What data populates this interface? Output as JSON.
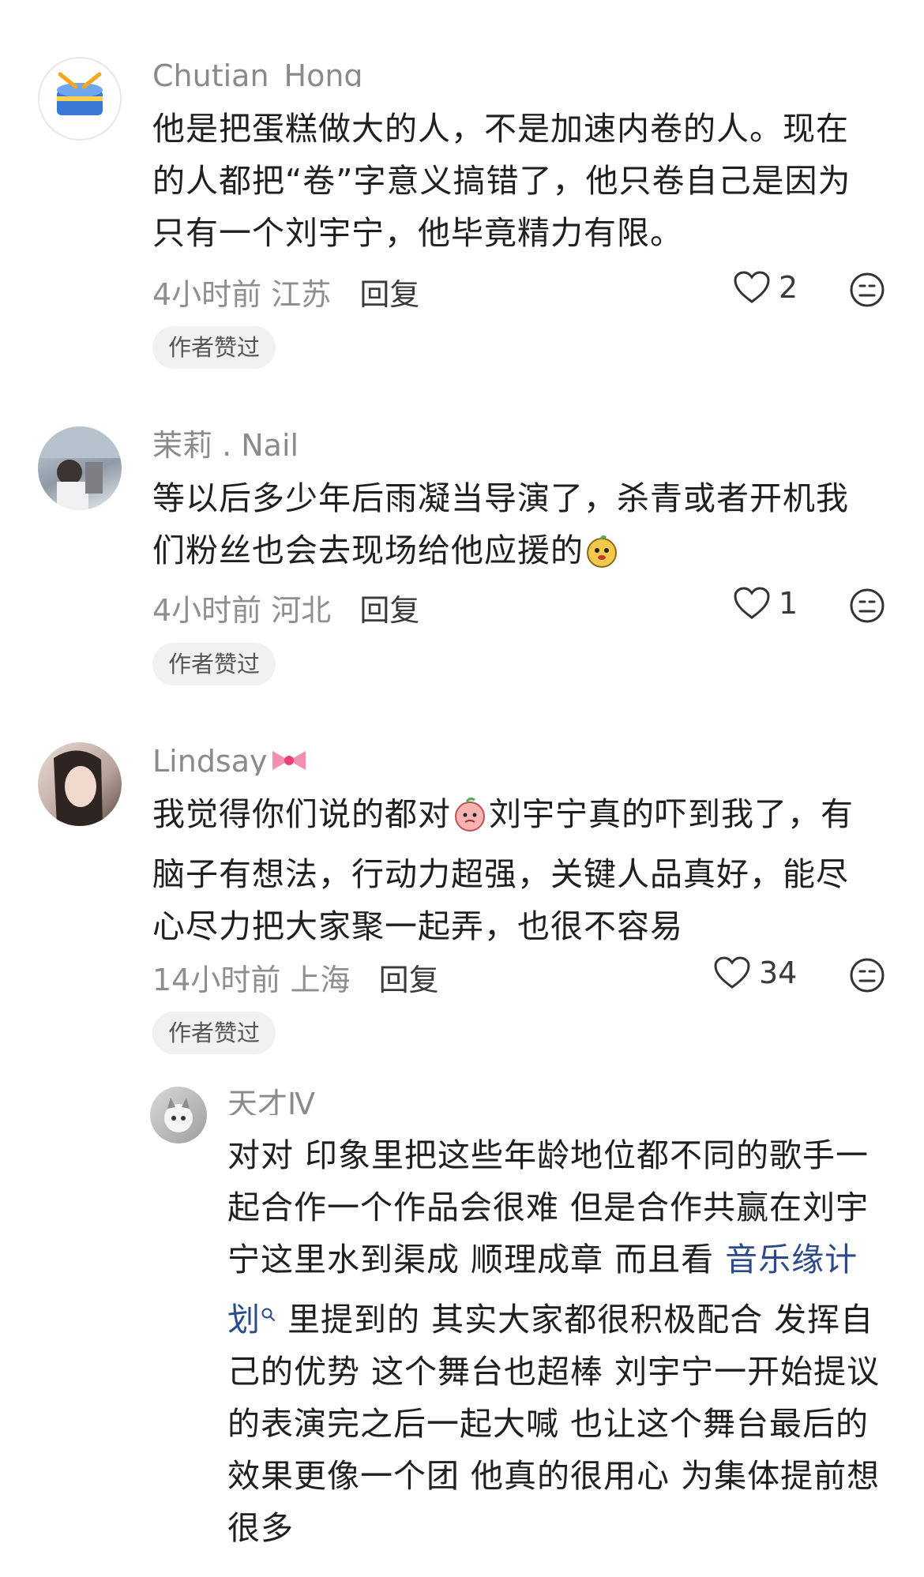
{
  "comments": [
    {
      "username": "Chutian_Hong",
      "text": "他是把蛋糕做大的人，不是加速内卷的人。现在的人都把“卷”字意义搞错了，他只卷自己是因为只有一个刘宇宁，他毕竟精力有限。",
      "time": "4小时前",
      "location": "江苏",
      "reply_label": "回复",
      "likes": "2",
      "badge": "作者赞过"
    },
    {
      "username": "茉莉 . Nail",
      "text": "等以后多少年后雨凝当导演了，杀青或者开机我们粉丝也会去现场给他应援的",
      "time": "4小时前",
      "location": "河北",
      "reply_label": "回复",
      "likes": "1",
      "badge": "作者赞过"
    },
    {
      "username": "Lindsay",
      "text_before": "我觉得你们说的都对",
      "text_after": "刘宇宁真的吓到我了，有脑子有想法，行动力超强，关键人品真好，能尽心尽力把大家聚一起弄，也很不容易",
      "time": "14小时前",
      "location": "上海",
      "reply_label": "回复",
      "likes": "34",
      "badge": "作者赞过"
    }
  ],
  "reply": {
    "username": "天才Ⅳ",
    "text_before": "对对 印象里把这些年龄地位都不同的歌手一起合作一个作品会很难 但是合作共赢在刘宇宁这里水到渠成 顺理成章 而且看 ",
    "link_text": "音乐缘计划",
    "text_after": " 里提到的 其实大家都很积极配合 发挥自己的优势 这个舞台也超棒 刘宇宁一开始提议的表演完之后一起大喊 也让这个舞台最后的效果更像一个团 他真的很用心 为集体提前想很多"
  },
  "colors": {
    "link": "#2a4a8c",
    "muted": "#8e8e8e",
    "badge_bg": "#f1f1f1"
  }
}
